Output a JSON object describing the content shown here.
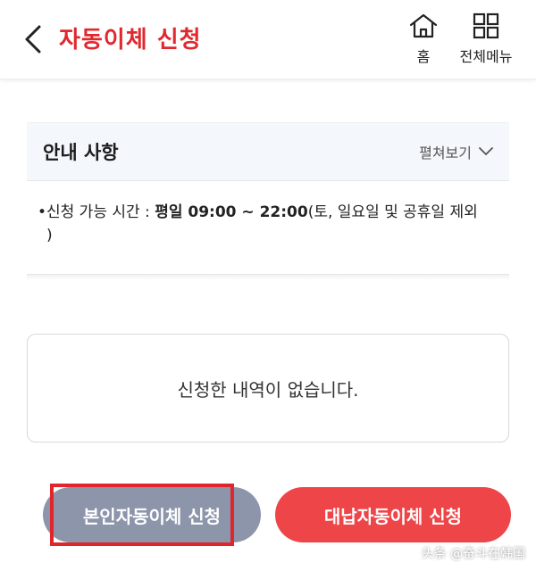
{
  "header": {
    "title": "자동이체 신청",
    "home_label": "홈",
    "menu_label": "전체메뉴"
  },
  "notice": {
    "title": "안내 사항",
    "expand_label": "펼쳐보기",
    "bullet_prefix": "신청 가능 시간 : ",
    "bullet_bold": "평일 09:00 ~ 22:00",
    "bullet_suffix": "(토, 일요일 및 공휴일 제외",
    "bullet_suffix_line2": ")"
  },
  "history": {
    "empty_text": "신청한 내역이 없습니다."
  },
  "actions": {
    "self_label": "본인자동이체 신청",
    "proxy_label": "대납자동이체 신청"
  },
  "watermark": "头条 @奋斗在韩国",
  "colors": {
    "accent": "#e0282e",
    "self_button": "#8d95ab",
    "proxy_button": "#ee4548",
    "highlight_box": "#e0262c"
  }
}
